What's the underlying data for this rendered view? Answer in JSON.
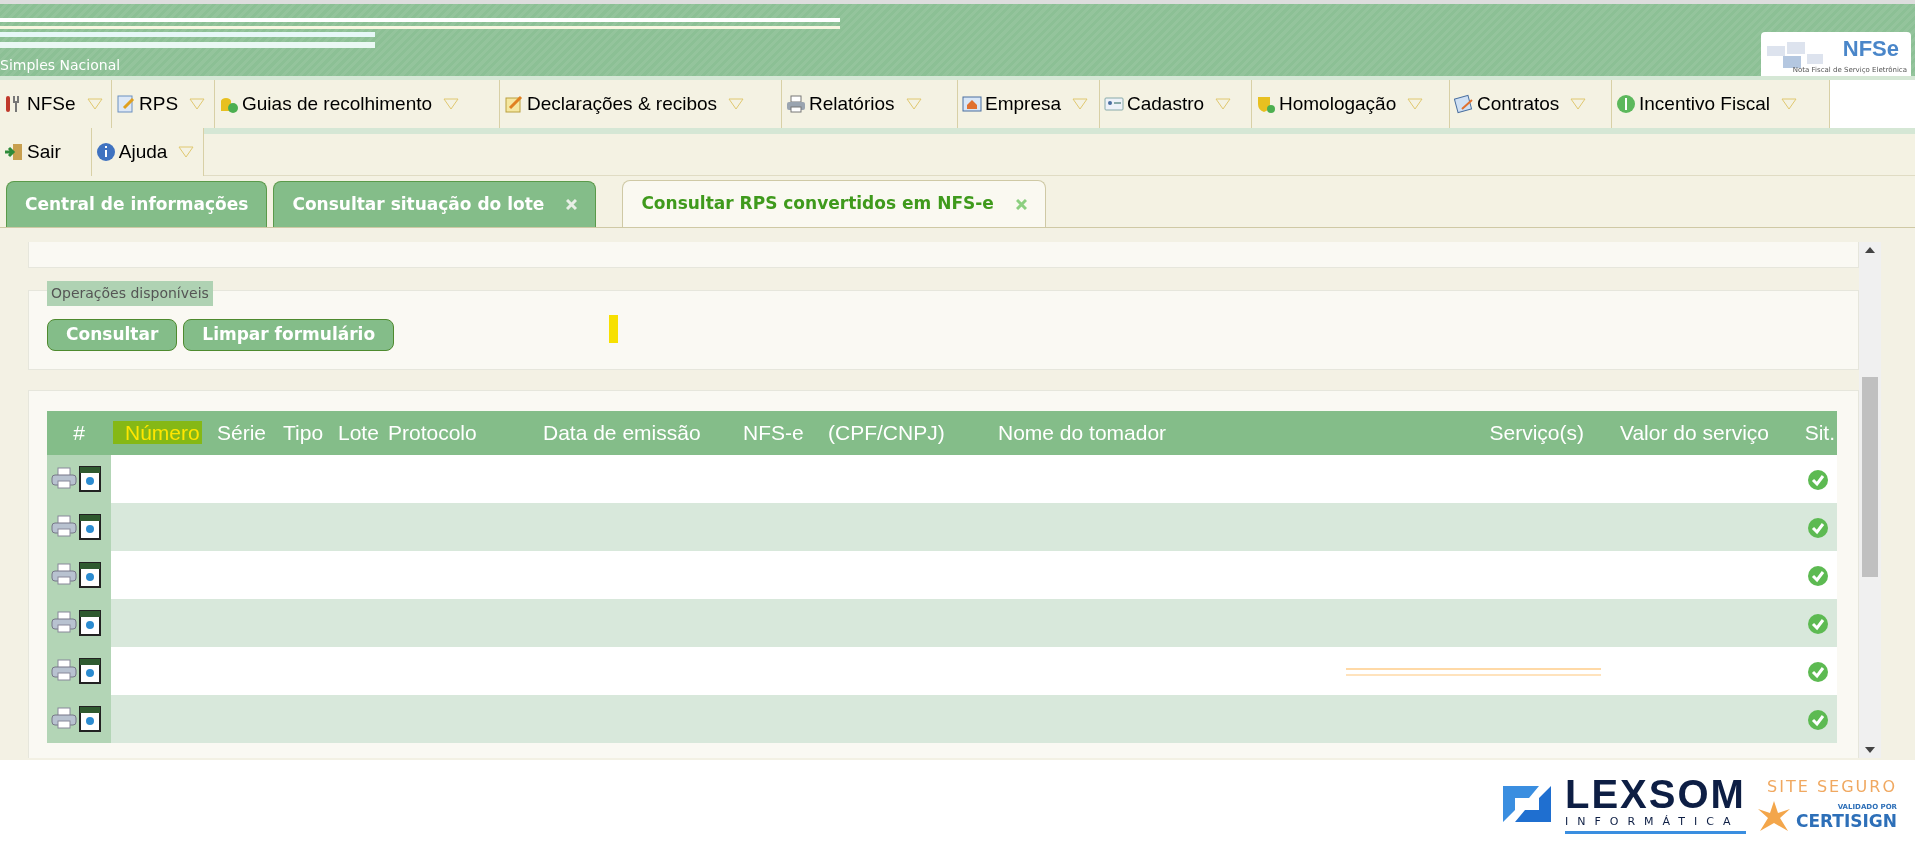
{
  "header": {
    "subtitle": "Simples Nacional",
    "logo": {
      "text": "NFSe",
      "tagline": "Nota Fiscal de Serviço Eletrônica"
    }
  },
  "menu": [
    {
      "label": "NFSe"
    },
    {
      "label": "RPS"
    },
    {
      "label": "Guias de recolhimento"
    },
    {
      "label": "Declarações & recibos"
    },
    {
      "label": "Relatórios"
    },
    {
      "label": "Empresa"
    },
    {
      "label": "Cadastro"
    },
    {
      "label": "Homologação"
    },
    {
      "label": "Contratos"
    },
    {
      "label": "Incentivo Fiscal"
    },
    {
      "label": "Sair",
      "kind": "link"
    },
    {
      "label": "Ajuda"
    }
  ],
  "tabs": [
    {
      "label": "Central de informações",
      "selected": false,
      "closable": false
    },
    {
      "label": "Consultar situação do lote",
      "selected": false,
      "closable": true
    },
    {
      "label": "Consultar RPS convertidos em NFS-e",
      "selected": true,
      "closable": true
    }
  ],
  "operations": {
    "legend": "Operações disponíveis",
    "buttons": [
      "Consultar",
      "Limpar formulário"
    ]
  },
  "table": {
    "columns": [
      {
        "label": "#",
        "selected": false
      },
      {
        "label": "Número",
        "selected": true
      },
      {
        "label": "Série",
        "selected": false
      },
      {
        "label": "Tipo",
        "selected": false
      },
      {
        "label": "Lote",
        "selected": false
      },
      {
        "label": "Protocolo",
        "selected": false
      },
      {
        "label": "Data de emissão",
        "selected": false
      },
      {
        "label": "NFS-e",
        "selected": false
      },
      {
        "label": "(CPF/CNPJ)",
        "selected": false
      },
      {
        "label": "Nome do tomador",
        "selected": false
      },
      {
        "label": "Serviço(s)",
        "selected": false
      },
      {
        "label": "Valor do serviço",
        "selected": false
      },
      {
        "label": "Sit.",
        "selected": false
      }
    ],
    "rows": [
      {
        "approved": true
      },
      {
        "approved": true
      },
      {
        "approved": true
      },
      {
        "approved": true
      },
      {
        "approved": true
      },
      {
        "approved": true
      }
    ]
  },
  "footer": {
    "company": "LEXSOM",
    "company_sub": "INFORMÁTICA",
    "seal_top": "SITE SEGURO",
    "seal_small": "VALIDADO POR",
    "seal_name": "CERTISIGN"
  }
}
